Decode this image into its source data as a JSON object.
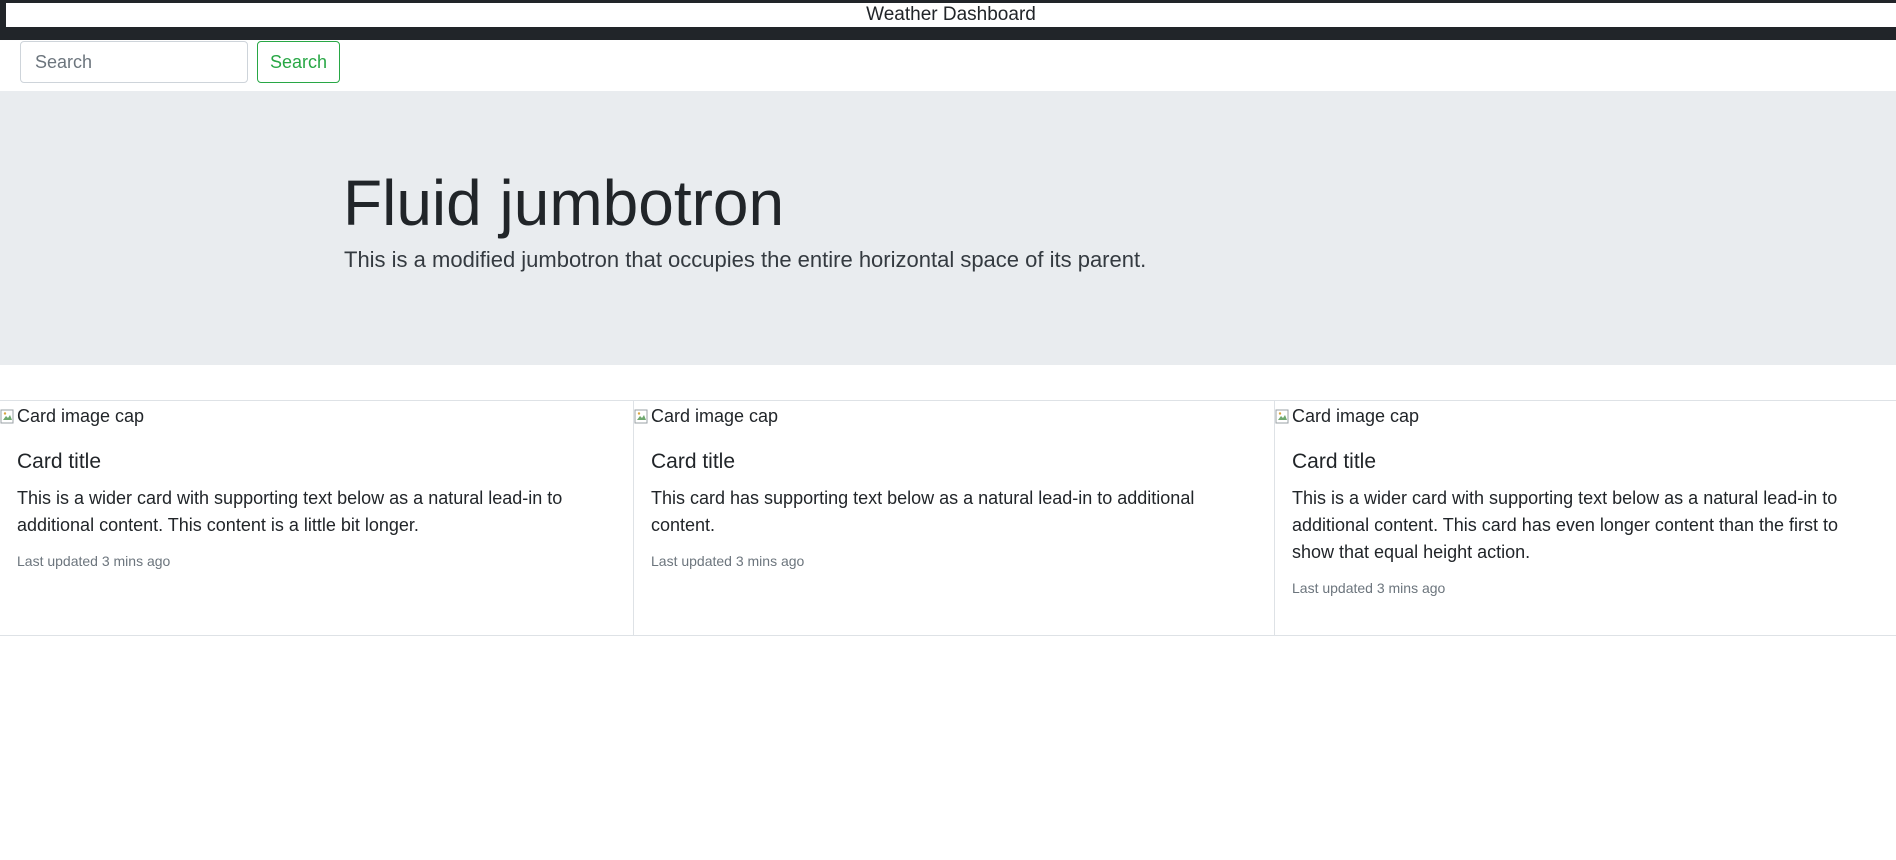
{
  "header": {
    "title": "Weather Dashboard"
  },
  "search": {
    "placeholder": "Search",
    "value": "",
    "button_label": "Search"
  },
  "jumbotron": {
    "title": "Fluid jumbotron",
    "lead": "This is a modified jumbotron that occupies the entire horizontal space of its parent."
  },
  "cards": [
    {
      "image_alt": "Card image cap",
      "title": "Card title",
      "text": "This is a wider card with supporting text below as a natural lead-in to additional content. This content is a little bit longer.",
      "updated": "Last updated 3 mins ago"
    },
    {
      "image_alt": "Card image cap",
      "title": "Card title",
      "text": "This card has supporting text below as a natural lead-in to additional content.",
      "updated": "Last updated 3 mins ago"
    },
    {
      "image_alt": "Card image cap",
      "title": "Card title",
      "text": "This is a wider card with supporting text below as a natural lead-in to additional content. This card has even longer content than the first to show that equal height action.",
      "updated": "Last updated 3 mins ago"
    }
  ],
  "colors": {
    "header_dark": "#212529",
    "jumbotron_bg": "#e9ecef",
    "success_green": "#28a745",
    "muted_text": "#6c757d",
    "border": "#dee2e6"
  },
  "icons": {
    "card_image": "broken-image-icon"
  }
}
